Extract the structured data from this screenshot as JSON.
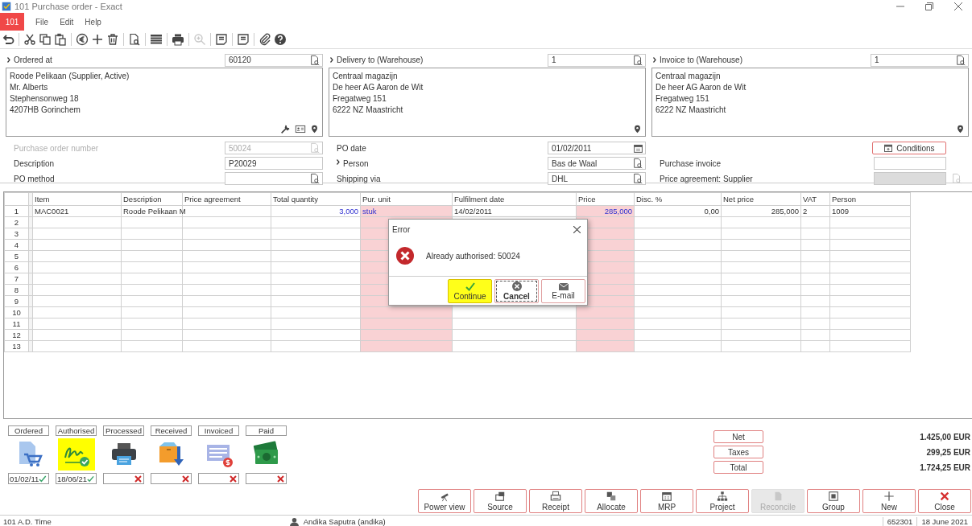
{
  "window": {
    "title": "101 Purchase order - Exact"
  },
  "menu": {
    "badge": "101",
    "items": [
      "File",
      "Edit",
      "Help"
    ]
  },
  "toolbar": [
    [
      {
        "kind": "undo"
      }
    ],
    [
      {
        "kind": "cut"
      },
      {
        "kind": "copy"
      },
      {
        "kind": "paste"
      }
    ],
    [
      {
        "kind": "currency"
      },
      {
        "kind": "add"
      },
      {
        "kind": "delete"
      }
    ],
    [
      {
        "kind": "preview"
      }
    ],
    [
      {
        "kind": "list"
      }
    ],
    [
      {
        "kind": "print"
      }
    ],
    [
      {
        "kind": "zoom",
        "disabled": true
      }
    ],
    [
      {
        "kind": "note"
      }
    ],
    [
      {
        "kind": "note"
      }
    ],
    [
      {
        "kind": "attach"
      },
      {
        "kind": "help"
      }
    ]
  ],
  "address_panels": [
    {
      "label": "Ordered at",
      "code": "60120",
      "kind": "supplier",
      "lines": [
        "Roode Pelikaan (Supplier, Active)",
        "Mr. Alberts",
        "Stephensonweg 18",
        "4207HB Gorinchem"
      ]
    },
    {
      "label": "Delivery to (Warehouse)",
      "code": "1",
      "kind": "warehouse",
      "lines": [
        "Centraal magazijn",
        "De heer AG Aaron de Wit",
        "Fregatweg 151",
        "6222 NZ Maastricht"
      ]
    },
    {
      "label": "Invoice to (Warehouse)",
      "code": "1",
      "kind": "warehouse",
      "lines": [
        "Centraal magazijn",
        "De heer AG Aaron de Wit",
        "Fregatweg 151",
        "6222 NZ Maastricht"
      ]
    }
  ],
  "form": [
    [
      {
        "label": "Purchase order number",
        "value": "50024",
        "kind": "lookup",
        "disabled": true
      },
      {
        "label": "Description",
        "value": "P20029",
        "kind": "text"
      },
      {
        "label": "PO method",
        "kind": "lookup"
      }
    ],
    [
      {
        "label": "PO date",
        "value": "01/02/2011",
        "kind": "date"
      },
      {
        "label": "Person",
        "value": "Bas de Waal",
        "kind": "lookup",
        "expandable": true
      },
      {
        "label": "Shipping via",
        "value": "DHL",
        "kind": "lookup"
      }
    ],
    [
      {
        "label": "Conditions",
        "kind": "button"
      },
      {
        "label": "Purchase invoice",
        "kind": "text"
      },
      {
        "label": "Price agreement: Supplier",
        "kind": "locked"
      }
    ]
  ],
  "grid": {
    "columns": [
      {
        "label": "Item",
        "highlighted": false,
        "kind": "text"
      },
      {
        "label": "Description",
        "highlighted": false,
        "kind": "text"
      },
      {
        "label": "Price agreement",
        "highlighted": false,
        "kind": "text"
      },
      {
        "label": "Total quantity",
        "highlighted": false,
        "kind": "number"
      },
      {
        "label": "Pur. unit",
        "highlighted": true,
        "kind": "text"
      },
      {
        "label": "Fulfilment date",
        "highlighted": false,
        "kind": "text"
      },
      {
        "label": "Price",
        "highlighted": true,
        "kind": "number"
      },
      {
        "label": "Disc. %",
        "highlighted": false,
        "kind": "number"
      },
      {
        "label": "Net price",
        "highlighted": false,
        "kind": "number"
      },
      {
        "label": "VAT",
        "highlighted": false,
        "kind": "text"
      },
      {
        "label": "Person",
        "highlighted": false,
        "kind": "text"
      }
    ],
    "rows": [
      {
        "number": "1",
        "cells": [
          {
            "text": "MAC0021",
            "linked": false
          },
          {
            "text": "Roode Pelikaan M",
            "linked": false
          },
          null,
          {
            "text": "3,000",
            "linked": true
          },
          {
            "text": "stuk",
            "linked": true
          },
          {
            "text": "14/02/2011",
            "linked": false
          },
          {
            "text": "285,000",
            "linked": true
          },
          {
            "text": "0,00",
            "linked": false
          },
          {
            "text": "285,000",
            "linked": false
          },
          {
            "text": "2",
            "linked": false
          },
          {
            "text": "1009",
            "linked": false
          }
        ]
      },
      {
        "number": "2"
      },
      {
        "number": "3"
      },
      {
        "number": "4"
      },
      {
        "number": "5"
      },
      {
        "number": "6"
      },
      {
        "number": "7"
      },
      {
        "number": "8"
      },
      {
        "number": "9"
      },
      {
        "number": "10"
      },
      {
        "number": "11"
      },
      {
        "number": "12"
      },
      {
        "number": "13"
      }
    ]
  },
  "dialog": {
    "title": "Error",
    "message": "Already authorised: 50024",
    "buttons": [
      {
        "label": "Continue",
        "kind": "continue",
        "selected": true,
        "focused": false
      },
      {
        "label": "Cancel",
        "kind": "cancel",
        "selected": false,
        "focused": true
      },
      {
        "label": "E-mail",
        "kind": "email",
        "selected": false,
        "focused": false
      }
    ]
  },
  "stages": [
    {
      "label": "Ordered",
      "kind": "ordered",
      "date": "01/02/11",
      "done": true,
      "selected": false
    },
    {
      "label": "Authorised",
      "kind": "authorised",
      "date": "18/06/21",
      "done": true,
      "selected": true
    },
    {
      "label": "Processed",
      "kind": "processed",
      "done": false,
      "selected": false
    },
    {
      "label": "Received",
      "kind": "received",
      "done": false,
      "selected": false
    },
    {
      "label": "Invoiced",
      "kind": "invoiced",
      "done": false,
      "selected": false
    },
    {
      "label": "Paid",
      "kind": "paid",
      "done": false,
      "selected": false
    }
  ],
  "totals": [
    {
      "label": "Net",
      "value": "1.425,00 EUR"
    },
    {
      "label": "Taxes",
      "value": "299,25 EUR"
    },
    {
      "label": "Total",
      "value": "1.724,25 EUR"
    }
  ],
  "actions": [
    {
      "label": "Power view",
      "kind": "power_view",
      "disabled": false
    },
    {
      "label": "Source",
      "kind": "source",
      "disabled": false
    },
    {
      "label": "Receipt",
      "kind": "receipt",
      "disabled": false
    },
    {
      "label": "Allocate",
      "kind": "allocate",
      "disabled": false
    },
    {
      "label": "MRP",
      "kind": "mrp",
      "disabled": false
    },
    {
      "label": "Project",
      "kind": "project",
      "disabled": false
    },
    {
      "label": "Reconcile",
      "kind": "reconcile",
      "disabled": true
    },
    {
      "label": "Group",
      "kind": "group",
      "disabled": false
    },
    {
      "label": "New",
      "kind": "new",
      "disabled": false
    },
    {
      "label": "Close",
      "kind": "close",
      "disabled": false
    }
  ],
  "status_bar": {
    "left": "101 A.D. Time",
    "user": "Andika Saputra (andika)",
    "number": "652301",
    "date": "18 June 2021"
  }
}
